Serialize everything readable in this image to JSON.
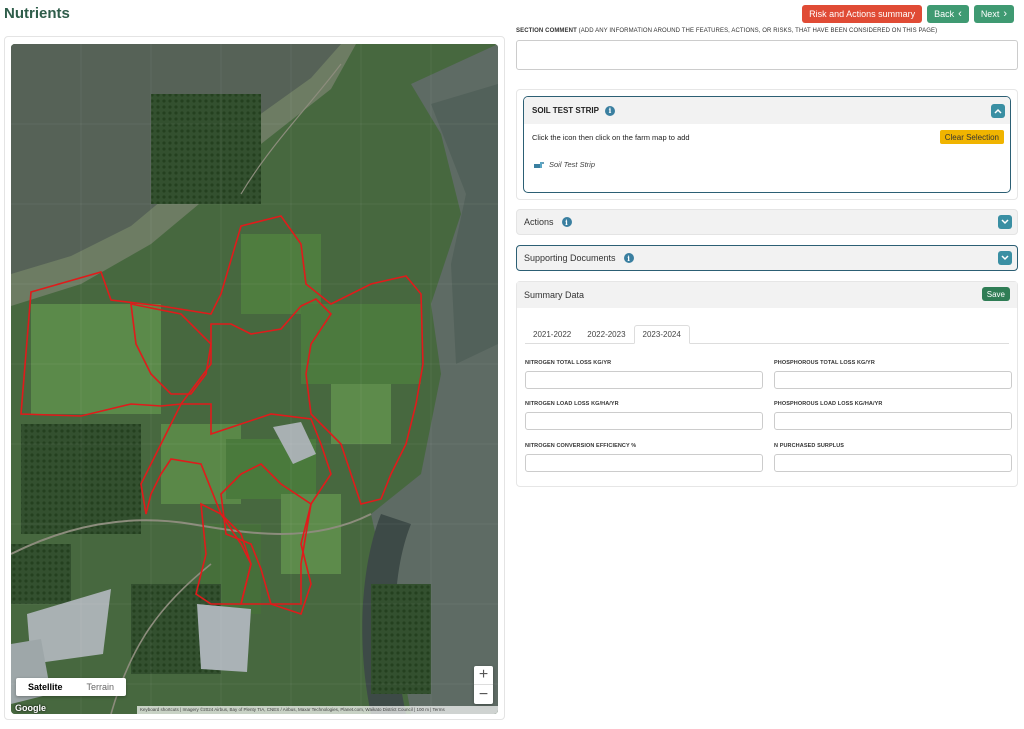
{
  "page": {
    "title": "Nutrients"
  },
  "toolbar": {
    "risk_label": "Risk and Actions summary",
    "back_label": "Back",
    "next_label": "Next",
    "back_glyph": "‹",
    "next_glyph": "›"
  },
  "map": {
    "types": [
      "Satellite",
      "Terrain"
    ],
    "selected_type": "Satellite",
    "zoom_in": "+",
    "zoom_out": "−",
    "logo": "Google",
    "attribution": "Keyboard shortcuts  |  Imagery ©2024 Airbus, Bay of Plenty TIA, CNES / Airbus, Maxar Technologies, Planet.com, Waikato District Council  |  100 m  |  Terms"
  },
  "section_comment": {
    "label_bold": "SECTION COMMENT",
    "label_rest": " (ADD ANY INFORMATION AROUND THE FEATURES, ACTIONS, OR RISKS, THAT HAVE BEEN CONSIDERED ON THIS PAGE)",
    "value": ""
  },
  "soil_test_strip": {
    "title": "SOIL TEST STRIP",
    "instruction": "Click the icon then click on the farm map to add",
    "clear_label": "Clear Selection",
    "item_label": "Soil Test Strip"
  },
  "actions": {
    "title": "Actions"
  },
  "supporting_documents": {
    "title": "Supporting Documents"
  },
  "summary": {
    "title": "Summary Data",
    "save_label": "Save",
    "tabs": [
      "2021-2022",
      "2022-2023",
      "2023-2024"
    ],
    "active_tab": "2023-2024",
    "fields": {
      "nitrogen_total_loss": {
        "label": "NITROGEN TOTAL LOSS KG/YR",
        "value": ""
      },
      "phosphorous_total_loss": {
        "label": "PHOSPHOROUS TOTAL LOSS KG/YR",
        "value": ""
      },
      "nitrogen_load_loss": {
        "label": "NITROGEN LOAD LOSS KG/HA/YR",
        "value": ""
      },
      "phosphorous_load_loss": {
        "label": "PHOSPHOROUS LOAD LOSS KG/HA/YR",
        "value": ""
      },
      "nitrogen_conversion": {
        "label": "NITROGEN CONVERSION EFFICIENCY %",
        "value": ""
      },
      "n_purchased_surplus": {
        "label": "N PURCHASED SURPLUS",
        "value": ""
      }
    }
  },
  "colors": {
    "primary_green": "#2f5d4a",
    "button_green": "#3f9a72",
    "button_red": "#e04b35",
    "button_yellow": "#f0b400",
    "accent_teal": "#3a8fa3",
    "paddock_outline": "#e01b1b"
  }
}
